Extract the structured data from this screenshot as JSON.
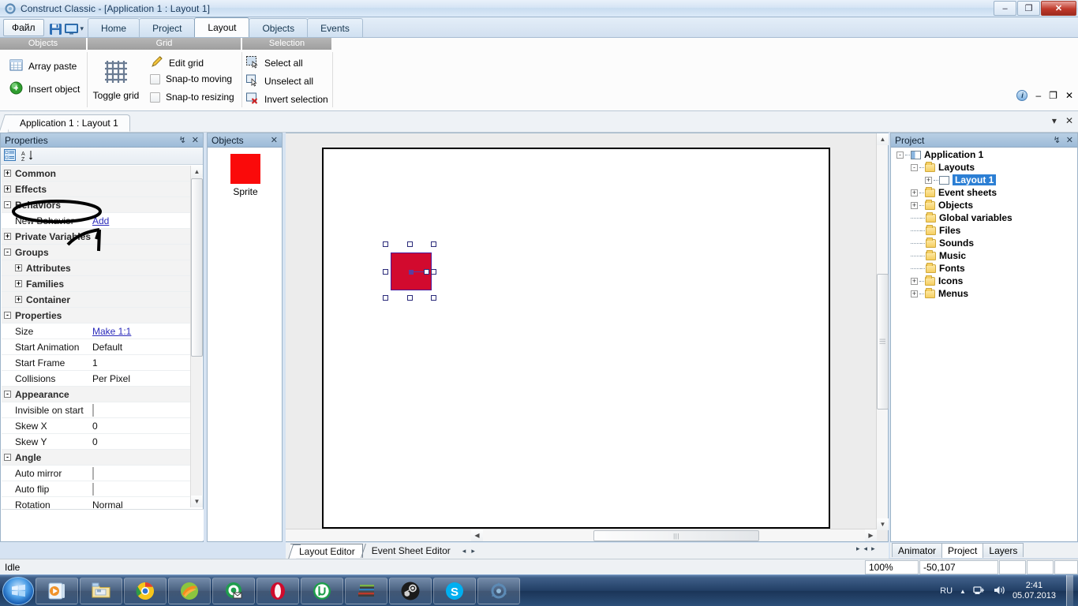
{
  "window": {
    "title": "Construct Classic - [Application 1 : Layout 1]",
    "minimize": "–",
    "maximize": "❐",
    "close": "✕"
  },
  "ribbon": {
    "file_button": "Файл",
    "quick_access": [
      {
        "name": "save-icon",
        "label": "Save"
      },
      {
        "name": "run-icon",
        "label": "Run"
      },
      {
        "name": "customize-dropdown-icon",
        "label": "▾"
      }
    ],
    "tabs": [
      {
        "label": "Home",
        "active": false
      },
      {
        "label": "Project",
        "active": false
      },
      {
        "label": "Layout",
        "active": true
      },
      {
        "label": "Objects",
        "active": false
      },
      {
        "label": "Events",
        "active": false
      }
    ],
    "groups": [
      {
        "title": "Objects",
        "items": [
          {
            "label": "Array paste",
            "icon": "array-paste-icon"
          },
          {
            "label": "Insert object",
            "icon": "insert-object-icon"
          },
          {
            "label": "Toggle grid",
            "icon": "toggle-grid-icon"
          }
        ]
      },
      {
        "title": "Grid",
        "items": [
          {
            "label": "Edit grid",
            "icon": "edit-grid-icon"
          },
          {
            "label": "Snap-to moving",
            "icon": "checkbox-icon"
          },
          {
            "label": "Snap-to resizing",
            "icon": "checkbox-icon"
          }
        ]
      },
      {
        "title": "Selection",
        "items": [
          {
            "label": "Select all",
            "icon": "select-all-icon"
          },
          {
            "label": "Unselect all",
            "icon": "unselect-all-icon"
          },
          {
            "label": "Invert selection",
            "icon": "invert-selection-icon"
          }
        ]
      }
    ]
  },
  "mdi": {
    "document_tab": "Application 1 : Layout 1",
    "info_icon": "i",
    "minimize": "–",
    "restore": "❐",
    "close": "✕",
    "dropdown": "▾"
  },
  "properties": {
    "title": "Properties",
    "pin": "↯",
    "close": "✕",
    "toolbar": [
      {
        "name": "categorized-button",
        "label": "Categorized"
      },
      {
        "name": "alphabetical-button",
        "label": "A↓"
      }
    ],
    "rows": [
      {
        "type": "category",
        "expander": "+",
        "label": "Common",
        "indent": 0
      },
      {
        "type": "category",
        "expander": "+",
        "label": "Effects",
        "indent": 0
      },
      {
        "type": "category",
        "expander": "-",
        "label": "Behaviors",
        "indent": 0
      },
      {
        "type": "prop",
        "name": "New Behavior",
        "value": "Add",
        "link": true
      },
      {
        "type": "category",
        "expander": "+",
        "label": "Private Variables",
        "indent": 0
      },
      {
        "type": "category",
        "expander": "-",
        "label": "Groups",
        "indent": 0
      },
      {
        "type": "category",
        "expander": "+",
        "label": "Attributes",
        "indent": 1
      },
      {
        "type": "category",
        "expander": "+",
        "label": "Families",
        "indent": 1
      },
      {
        "type": "category",
        "expander": "+",
        "label": "Container",
        "indent": 1
      },
      {
        "type": "category",
        "expander": "-",
        "label": "Properties",
        "indent": 0
      },
      {
        "type": "prop",
        "name": "Size",
        "value": "Make 1:1",
        "link": true
      },
      {
        "type": "prop",
        "name": "Start Animation",
        "value": "Default"
      },
      {
        "type": "prop",
        "name": "Start Frame",
        "value": "1"
      },
      {
        "type": "prop",
        "name": "Collisions",
        "value": "Per Pixel"
      },
      {
        "type": "category",
        "expander": "-",
        "label": "Appearance",
        "indent": 0
      },
      {
        "type": "prop",
        "name": "Invisible on start",
        "value": "",
        "checkbox": true
      },
      {
        "type": "prop",
        "name": "Skew X",
        "value": "0"
      },
      {
        "type": "prop",
        "name": "Skew Y",
        "value": "0"
      },
      {
        "type": "category",
        "expander": "-",
        "label": "Angle",
        "indent": 0
      },
      {
        "type": "prop",
        "name": "Auto mirror",
        "value": "",
        "checkbox": true
      },
      {
        "type": "prop",
        "name": "Auto flip",
        "value": "",
        "checkbox": true
      },
      {
        "type": "prop",
        "name": "Rotation",
        "value": "Normal"
      }
    ]
  },
  "objects_panel": {
    "title": "Objects",
    "close": "✕",
    "items": [
      {
        "label": "Sprite",
        "color": "#fa0a0a"
      }
    ]
  },
  "project_panel": {
    "title": "Project",
    "pin": "↯",
    "close": "✕",
    "tree": [
      {
        "label": "Application 1",
        "depth": 0,
        "expander": "-",
        "icon": "application-icon"
      },
      {
        "label": "Layouts",
        "depth": 1,
        "expander": "-",
        "icon": "folder-icon"
      },
      {
        "label": "Layout 1",
        "depth": 2,
        "expander": "+",
        "icon": "layout-icon",
        "selected": true
      },
      {
        "label": "Event sheets",
        "depth": 1,
        "expander": "+",
        "icon": "folder-icon"
      },
      {
        "label": "Objects",
        "depth": 1,
        "expander": "+",
        "icon": "folder-icon"
      },
      {
        "label": "Global variables",
        "depth": 1,
        "expander": "",
        "icon": "folder-icon"
      },
      {
        "label": "Files",
        "depth": 1,
        "expander": "",
        "icon": "folder-icon"
      },
      {
        "label": "Sounds",
        "depth": 1,
        "expander": "",
        "icon": "folder-icon"
      },
      {
        "label": "Music",
        "depth": 1,
        "expander": "",
        "icon": "folder-icon"
      },
      {
        "label": "Fonts",
        "depth": 1,
        "expander": "",
        "icon": "folder-icon"
      },
      {
        "label": "Icons",
        "depth": 1,
        "expander": "+",
        "icon": "folder-icon"
      },
      {
        "label": "Menus",
        "depth": 1,
        "expander": "+",
        "icon": "folder-icon"
      }
    ],
    "bottom_tabs": [
      {
        "label": "Animator",
        "active": false
      },
      {
        "label": "Project",
        "active": true
      },
      {
        "label": "Layers",
        "active": false
      }
    ]
  },
  "canvas": {
    "sprite_color": "#d20a2e",
    "sprite_border": "#4b1a9a",
    "editor_tabs": [
      {
        "label": "Layout Editor",
        "active": true
      },
      {
        "label": "Event Sheet Editor",
        "active": false
      }
    ],
    "nav_prev": "◂",
    "nav_next": "▸"
  },
  "statusbar": {
    "status": "Idle",
    "zoom": "100%",
    "coordinates": "-50,107"
  },
  "taskbar": {
    "start_label": "Start",
    "buttons": [
      {
        "name": "media-player-icon",
        "label": "Windows Media Player"
      },
      {
        "name": "explorer-icon",
        "label": "Windows Explorer"
      },
      {
        "name": "chrome-icon",
        "label": "Google Chrome"
      },
      {
        "name": "firefox-icon",
        "label": "Firefox"
      },
      {
        "name": "mail-icon",
        "label": "Mail"
      },
      {
        "name": "opera-icon",
        "label": "Opera"
      },
      {
        "name": "utorrent-icon",
        "label": "uTorrent"
      },
      {
        "name": "winrar-icon",
        "label": "WinRAR"
      },
      {
        "name": "steam-icon",
        "label": "Steam"
      },
      {
        "name": "skype-icon",
        "label": "Skype"
      },
      {
        "name": "construct-icon",
        "label": "Construct Classic"
      }
    ],
    "tray": {
      "language": "RU",
      "show_hidden": "▲",
      "network_icon": "network-icon",
      "volume_icon": "volume-icon",
      "time": "2:41",
      "date": "05.07.2013"
    }
  }
}
